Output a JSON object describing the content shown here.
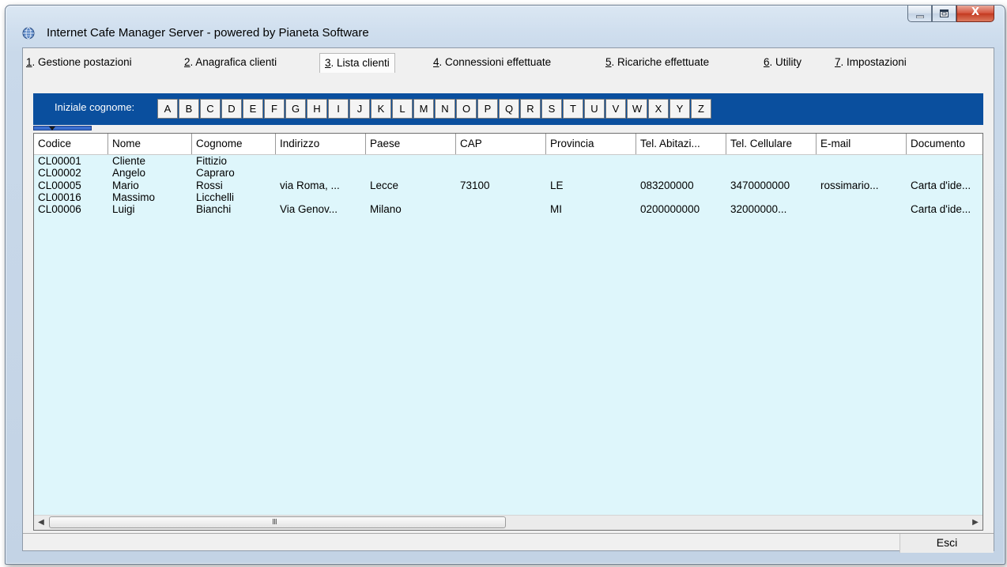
{
  "window": {
    "title": "Internet Cafe Manager Server - powered by Pianeta Software"
  },
  "caption": {
    "minimize": "▭",
    "maximize": "□",
    "close": "X"
  },
  "tabs": [
    {
      "key": "1",
      "label": ". Gestione postazioni"
    },
    {
      "key": "2",
      "label": ". Anagrafica clienti"
    },
    {
      "key": "3",
      "label": ". Lista clienti",
      "active": true
    },
    {
      "key": "4",
      "label": ". Connessioni effettuate"
    },
    {
      "key": "5",
      "label": ". Ricariche effettuate"
    },
    {
      "key": "6",
      "label": ". Utility"
    },
    {
      "key": "7",
      "label": ". Impostazioni"
    }
  ],
  "alphabet": {
    "label": "Iniziale cognome:",
    "letters": [
      "A",
      "B",
      "C",
      "D",
      "E",
      "F",
      "G",
      "H",
      "I",
      "J",
      "K",
      "L",
      "M",
      "N",
      "O",
      "P",
      "Q",
      "R",
      "S",
      "T",
      "U",
      "V",
      "W",
      "X",
      "Y",
      "Z"
    ]
  },
  "table": {
    "columns": [
      "Codice",
      "Nome",
      "Cognome",
      "Indirizzo",
      "Paese",
      "CAP",
      "Provincia",
      "Tel. Abitazi...",
      "Tel. Cellulare",
      "E-mail",
      "Documento"
    ],
    "rows": [
      [
        "CL00001",
        "Cliente",
        "Fittizio",
        "",
        "",
        "",
        "",
        "",
        "",
        "",
        ""
      ],
      [
        "CL00002",
        "Angelo",
        "Capraro",
        "",
        "",
        "",
        "",
        "",
        "",
        "",
        ""
      ],
      [
        "CL00005",
        "Mario",
        "Rossi",
        "via Roma, ...",
        "Lecce",
        "73100",
        "LE",
        "083200000",
        "3470000000",
        "rossimario...",
        "Carta d'ide..."
      ],
      [
        "CL00016",
        "Massimo",
        "Licchelli",
        "",
        "",
        "",
        "",
        "",
        "",
        "",
        ""
      ],
      [
        "CL00006",
        "Luigi",
        "Bianchi",
        "Via Genov...",
        "Milano",
        "",
        "MI",
        "0200000000",
        "32000000...",
        "",
        "Carta d'ide..."
      ]
    ]
  },
  "scrollbar": {
    "left_arrow": "◀",
    "right_arrow": "▶",
    "grip": "III"
  },
  "footer": {
    "exit_label": "Esci"
  },
  "colors": {
    "alpha_bar": "#0a4f9e",
    "grid_bg": "#def6fb"
  }
}
